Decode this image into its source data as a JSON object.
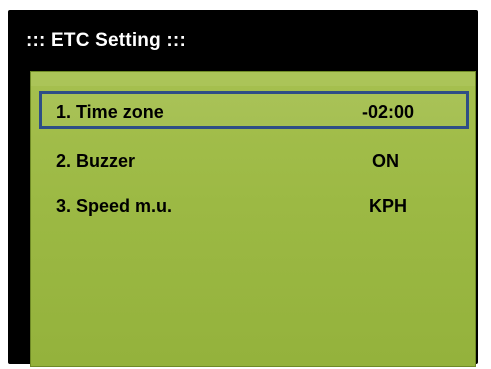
{
  "header": {
    "title": "::: ETC Setting :::"
  },
  "menu": {
    "items": [
      {
        "label": "1. Time zone",
        "value": "-02:00",
        "selected": true
      },
      {
        "label": "2. Buzzer",
        "value": "ON",
        "selected": false
      },
      {
        "label": "3. Speed m.u.",
        "value": "KPH",
        "selected": false
      }
    ]
  },
  "colors": {
    "frame": "#000000",
    "screen": "#9cb944",
    "selection_border": "#2e4e86",
    "title_text": "#ffffff",
    "item_text": "#000000"
  }
}
